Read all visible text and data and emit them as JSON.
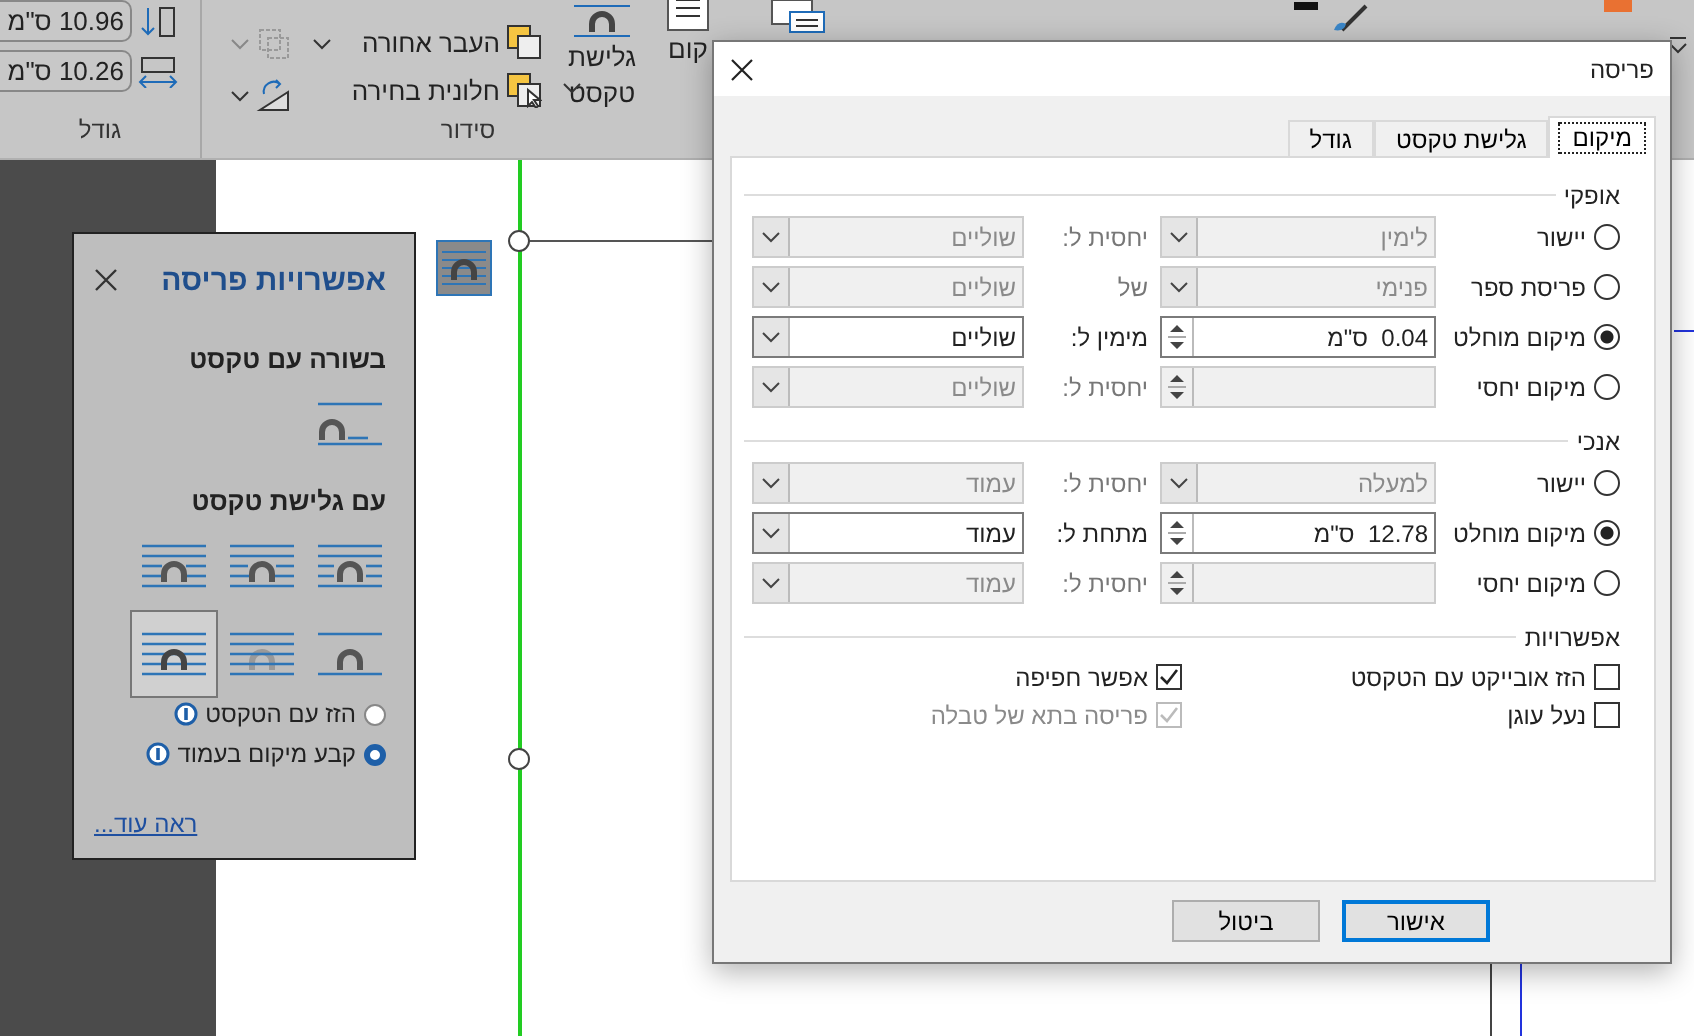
{
  "ribbon": {
    "size_fields": [
      {
        "value": "10.96 ס\"מ"
      },
      {
        "value": "10.26 ס\"מ"
      }
    ],
    "arrange_commands": [
      {
        "label": "העבר אחורה"
      },
      {
        "label": "חלונית בחירה"
      }
    ],
    "wrap_text_button": {
      "label": "גלישת טקסט"
    },
    "position_button": {
      "label": "קום"
    },
    "groups": [
      {
        "label": "סידור"
      },
      {
        "label": "גודל"
      }
    ]
  },
  "layout_options": {
    "title": "אפשרויות פריסה",
    "sections": [
      {
        "heading": "בשורה עם טקסט",
        "options": [
          {
            "kind": "inline",
            "selected": false
          }
        ]
      },
      {
        "heading": "עם גלישת טקסט",
        "options": [
          {
            "kind": "square",
            "selected": false
          },
          {
            "kind": "tight",
            "selected": false
          },
          {
            "kind": "through",
            "selected": false
          },
          {
            "kind": "top-bottom",
            "selected": false
          },
          {
            "kind": "behind",
            "selected": false
          },
          {
            "kind": "front",
            "selected": true
          }
        ]
      }
    ],
    "radios": [
      {
        "label": "הזז עם הטקסט",
        "selected": false
      },
      {
        "label": "קבע מיקום בעמוד",
        "selected": true
      }
    ],
    "see_more": "ראה עוד..."
  },
  "dialog": {
    "title": "פריסה",
    "tabs": [
      {
        "label": "מיקום",
        "selected": true
      },
      {
        "label": "גלישת טקסט",
        "selected": false
      },
      {
        "label": "גודל",
        "selected": false
      }
    ],
    "sections": [
      {
        "heading": "אופקי",
        "rows": [
          {
            "label": "יישור",
            "selected": false,
            "field": {
              "kind": "combo",
              "value": "לימין",
              "disabled": true
            },
            "relation": "יחסית ל:",
            "relation_disabled": true,
            "target": {
              "value": "שוליים",
              "disabled": true
            }
          },
          {
            "label": "פריסת ספר",
            "selected": false,
            "field": {
              "kind": "combo",
              "value": "פנימי",
              "disabled": true
            },
            "relation": "של",
            "relation_disabled": true,
            "target": {
              "value": "שוליים",
              "disabled": true
            }
          },
          {
            "label": "מיקום מוחלט",
            "selected": true,
            "field": {
              "kind": "spin",
              "value": "0.04  ס\"מ",
              "disabled": false
            },
            "relation": "מימין ל:",
            "relation_disabled": false,
            "target": {
              "value": "שוליים",
              "disabled": false
            }
          },
          {
            "label": "מיקום יחסי",
            "selected": false,
            "field": {
              "kind": "spin",
              "disabled": true
            },
            "relation": "יחסית ל:",
            "relation_disabled": true,
            "target": {
              "value": "שוליים",
              "disabled": true
            }
          }
        ]
      },
      {
        "heading": "אנכי",
        "rows": [
          {
            "label": "יישור",
            "selected": false,
            "field": {
              "kind": "combo",
              "value": "למעלה",
              "disabled": true
            },
            "relation": "יחסית ל:",
            "relation_disabled": true,
            "target": {
              "value": "עמוד",
              "disabled": true
            }
          },
          {
            "label": "מיקום מוחלט",
            "selected": true,
            "field": {
              "kind": "spin",
              "value": "12.78  ס\"מ",
              "disabled": false
            },
            "relation": "מתחת ל:",
            "relation_disabled": false,
            "target": {
              "value": "עמוד",
              "disabled": false
            }
          },
          {
            "label": "מיקום יחסי",
            "selected": false,
            "field": {
              "kind": "spin",
              "disabled": true
            },
            "relation": "יחסית ל:",
            "relation_disabled": true,
            "target": {
              "value": "עמוד",
              "disabled": true
            }
          }
        ]
      }
    ],
    "options_heading": "אפשרויות",
    "checkboxes": [
      {
        "label": "הזז אובייקט עם הטקסט",
        "checked": false,
        "disabled": false
      },
      {
        "label": "אפשר חפיפה",
        "checked": true,
        "disabled": false
      },
      {
        "label": "נעל עוגן",
        "checked": false,
        "disabled": false
      },
      {
        "label": "פריסה בתא של טבלה",
        "checked": true,
        "disabled": true
      }
    ],
    "buttons": [
      {
        "label": "אישור",
        "default": true
      },
      {
        "label": "ביטול",
        "default": false
      }
    ]
  }
}
